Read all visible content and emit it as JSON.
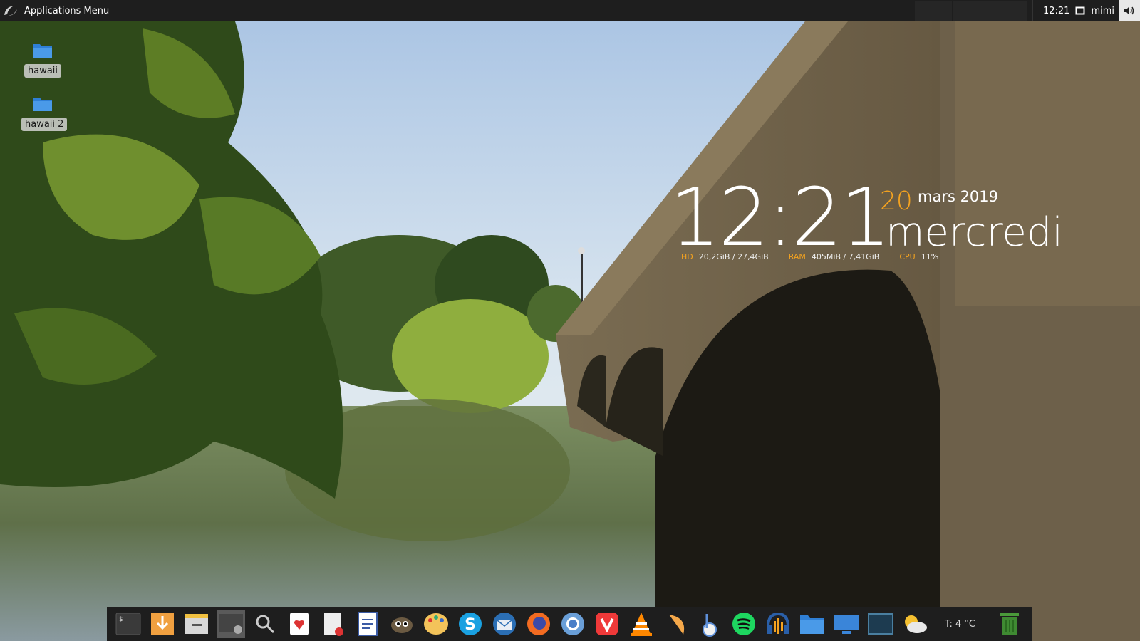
{
  "top_panel": {
    "menu_label": "Applications Menu",
    "clock": "12:21",
    "user": "mimi"
  },
  "desktop_icons": [
    {
      "label": "hawaii"
    },
    {
      "label": "hawaii 2"
    }
  ],
  "conky": {
    "time": "12:21",
    "day_number": "20",
    "month_year": "mars 2019",
    "weekday": "mercredi",
    "hd_label": "HD",
    "hd_value": "20,2GiB / 27,4GiB",
    "ram_label": "RAM",
    "ram_value": "405MiB / 7,41GiB",
    "cpu_label": "CPU",
    "cpu_value": "11%"
  },
  "dock": {
    "items": [
      {
        "icon": "terminal-icon"
      },
      {
        "icon": "download-icon"
      },
      {
        "icon": "file-manager-icon"
      },
      {
        "icon": "screenshot-icon",
        "active": true
      },
      {
        "icon": "search-icon"
      },
      {
        "icon": "solitaire-icon"
      },
      {
        "icon": "text-editor-icon"
      },
      {
        "icon": "document-writer-icon"
      },
      {
        "icon": "gimp-icon"
      },
      {
        "icon": "palette-icon"
      },
      {
        "icon": "skype-icon"
      },
      {
        "icon": "thunderbird-icon"
      },
      {
        "icon": "firefox-icon"
      },
      {
        "icon": "chromium-icon"
      },
      {
        "icon": "vivaldi-icon"
      },
      {
        "icon": "vlc-icon"
      },
      {
        "icon": "night-light-icon"
      },
      {
        "icon": "music-note-icon"
      },
      {
        "icon": "spotify-icon"
      },
      {
        "icon": "audio-editor-icon"
      },
      {
        "icon": "folder-icon"
      },
      {
        "icon": "desktop-icon"
      },
      {
        "icon": "window-icon"
      },
      {
        "icon": "weather-icon"
      }
    ],
    "weather_text": "T: 4 °C",
    "trash_icon": "trash-icon"
  },
  "colors": {
    "panel_bg": "#1e1e1e",
    "accent_orange": "#f5a31f",
    "folder_blue": "#3f8fe0"
  }
}
